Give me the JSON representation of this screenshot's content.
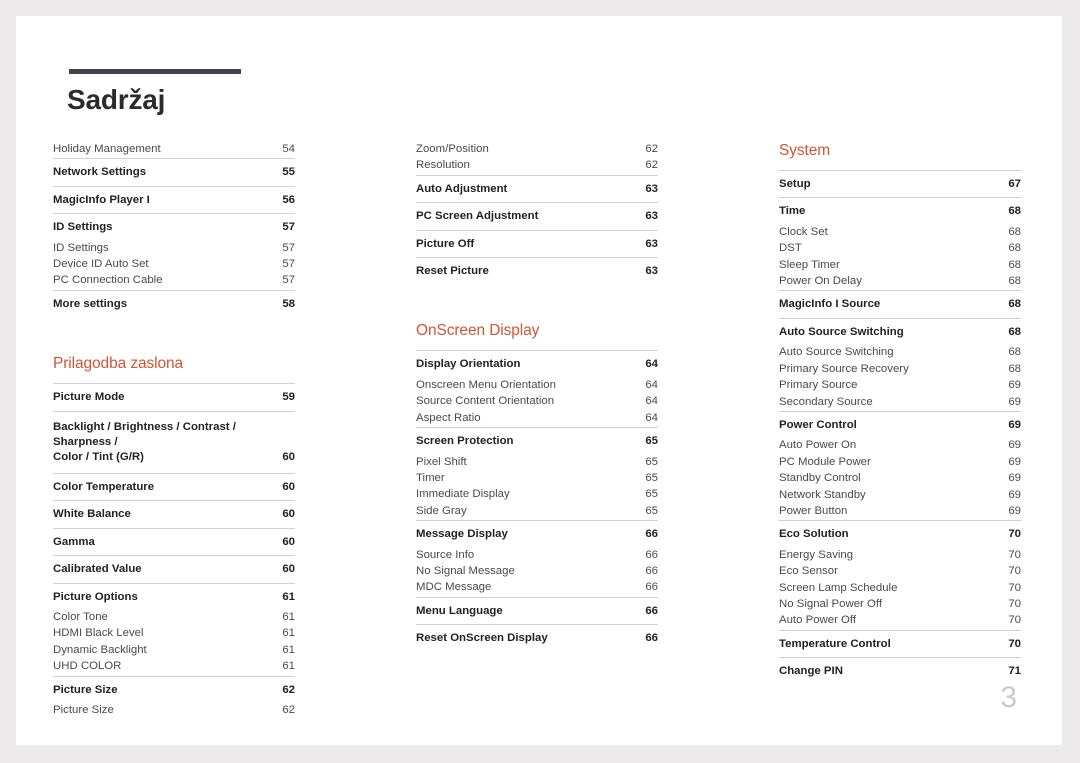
{
  "document": {
    "title": "Sadržaj",
    "folio": "3",
    "accent_color": "#cf5537",
    "rule_color": "#454250"
  },
  "columns": [
    {
      "name": "column-1",
      "groups": [
        {
          "rule": false,
          "entries": [
            {
              "label": "Holiday Management",
              "page": "54",
              "style": "sub"
            }
          ]
        },
        {
          "rule": true,
          "entries": [
            {
              "label": "Network Settings",
              "page": "55",
              "style": "head"
            }
          ]
        },
        {
          "rule": true,
          "entries": [
            {
              "label": "MagicInfo Player I",
              "page": "56",
              "style": "head"
            }
          ]
        },
        {
          "rule": true,
          "entries": [
            {
              "label": "ID Settings",
              "page": "57",
              "style": "head"
            },
            {
              "label": "ID Settings",
              "page": "57",
              "style": "sub"
            },
            {
              "label": "Device ID Auto Set",
              "page": "57",
              "style": "sub"
            },
            {
              "label": "PC Connection Cable",
              "page": "57",
              "style": "sub"
            }
          ]
        },
        {
          "rule": true,
          "entries": [
            {
              "label": "More settings",
              "page": "58",
              "style": "head"
            }
          ]
        }
      ],
      "section": {
        "heading": "Prilagodba zaslona",
        "groups": [
          {
            "rule": true,
            "entries": [
              {
                "label": "Picture Mode",
                "page": "59",
                "style": "head"
              }
            ]
          },
          {
            "rule": true,
            "entries": [
              {
                "label": "Backlight / Brightness / Contrast / Sharpness /",
                "label2": "Color / Tint (G/R)",
                "page": "60",
                "style": "wrap"
              }
            ]
          },
          {
            "rule": true,
            "entries": [
              {
                "label": "Color Temperature",
                "page": "60",
                "style": "head"
              }
            ]
          },
          {
            "rule": true,
            "entries": [
              {
                "label": "White Balance",
                "page": "60",
                "style": "head"
              }
            ]
          },
          {
            "rule": true,
            "entries": [
              {
                "label": "Gamma",
                "page": "60",
                "style": "head"
              }
            ]
          },
          {
            "rule": true,
            "entries": [
              {
                "label": "Calibrated Value",
                "page": "60",
                "style": "head"
              }
            ]
          },
          {
            "rule": true,
            "entries": [
              {
                "label": "Picture Options",
                "page": "61",
                "style": "head"
              },
              {
                "label": "Color Tone",
                "page": "61",
                "style": "sub"
              },
              {
                "label": "HDMI Black Level",
                "page": "61",
                "style": "sub"
              },
              {
                "label": "Dynamic Backlight",
                "page": "61",
                "style": "sub"
              },
              {
                "label": "UHD COLOR",
                "page": "61",
                "style": "sub"
              }
            ]
          },
          {
            "rule": true,
            "entries": [
              {
                "label": "Picture Size",
                "page": "62",
                "style": "head"
              },
              {
                "label": "Picture Size",
                "page": "62",
                "style": "sub"
              }
            ]
          }
        ]
      }
    },
    {
      "name": "column-2",
      "groups": [
        {
          "rule": false,
          "entries": [
            {
              "label": "Zoom/Position",
              "page": "62",
              "style": "sub"
            },
            {
              "label": "Resolution",
              "page": "62",
              "style": "sub"
            }
          ]
        },
        {
          "rule": true,
          "entries": [
            {
              "label": "Auto Adjustment",
              "page": "63",
              "style": "head"
            }
          ]
        },
        {
          "rule": true,
          "entries": [
            {
              "label": "PC Screen Adjustment",
              "page": "63",
              "style": "head"
            }
          ]
        },
        {
          "rule": true,
          "entries": [
            {
              "label": "Picture Off",
              "page": "63",
              "style": "head"
            }
          ]
        },
        {
          "rule": true,
          "entries": [
            {
              "label": "Reset Picture",
              "page": "63",
              "style": "head"
            }
          ]
        }
      ],
      "section": {
        "heading": "OnScreen Display",
        "groups": [
          {
            "rule": true,
            "entries": [
              {
                "label": "Display Orientation",
                "page": "64",
                "style": "head"
              },
              {
                "label": "Onscreen Menu Orientation",
                "page": "64",
                "style": "sub"
              },
              {
                "label": "Source Content Orientation",
                "page": "64",
                "style": "sub"
              },
              {
                "label": "Aspect Ratio",
                "page": "64",
                "style": "sub"
              }
            ]
          },
          {
            "rule": true,
            "entries": [
              {
                "label": "Screen Protection",
                "page": "65",
                "style": "head"
              },
              {
                "label": "Pixel Shift",
                "page": "65",
                "style": "sub"
              },
              {
                "label": "Timer",
                "page": "65",
                "style": "sub"
              },
              {
                "label": "Immediate Display",
                "page": "65",
                "style": "sub"
              },
              {
                "label": "Side Gray",
                "page": "65",
                "style": "sub"
              }
            ]
          },
          {
            "rule": true,
            "entries": [
              {
                "label": "Message Display",
                "page": "66",
                "style": "head"
              },
              {
                "label": "Source Info",
                "page": "66",
                "style": "sub"
              },
              {
                "label": "No Signal Message",
                "page": "66",
                "style": "sub"
              },
              {
                "label": "MDC Message",
                "page": "66",
                "style": "sub"
              }
            ]
          },
          {
            "rule": true,
            "entries": [
              {
                "label": "Menu Language",
                "page": "66",
                "style": "head"
              }
            ]
          },
          {
            "rule": true,
            "entries": [
              {
                "label": "Reset OnScreen Display",
                "page": "66",
                "style": "head"
              }
            ]
          }
        ]
      }
    },
    {
      "name": "column-3",
      "groups": [],
      "section": {
        "heading": "System",
        "groups": [
          {
            "rule": true,
            "entries": [
              {
                "label": "Setup",
                "page": "67",
                "style": "head"
              }
            ]
          },
          {
            "rule": true,
            "entries": [
              {
                "label": "Time",
                "page": "68",
                "style": "head"
              },
              {
                "label": "Clock Set",
                "page": "68",
                "style": "sub"
              },
              {
                "label": "DST",
                "page": "68",
                "style": "sub"
              },
              {
                "label": "Sleep Timer",
                "page": "68",
                "style": "sub"
              },
              {
                "label": "Power On Delay",
                "page": "68",
                "style": "sub"
              }
            ]
          },
          {
            "rule": true,
            "entries": [
              {
                "label": "MagicInfo I Source",
                "page": "68",
                "style": "head"
              }
            ]
          },
          {
            "rule": true,
            "entries": [
              {
                "label": "Auto Source Switching",
                "page": "68",
                "style": "head"
              },
              {
                "label": "Auto Source Switching",
                "page": "68",
                "style": "sub"
              },
              {
                "label": "Primary Source Recovery",
                "page": "68",
                "style": "sub"
              },
              {
                "label": "Primary Source",
                "page": "69",
                "style": "sub"
              },
              {
                "label": "Secondary Source",
                "page": "69",
                "style": "sub"
              }
            ]
          },
          {
            "rule": true,
            "entries": [
              {
                "label": "Power Control",
                "page": "69",
                "style": "head"
              },
              {
                "label": "Auto Power On",
                "page": "69",
                "style": "sub"
              },
              {
                "label": "PC Module Power",
                "page": "69",
                "style": "sub"
              },
              {
                "label": "Standby Control",
                "page": "69",
                "style": "sub"
              },
              {
                "label": "Network Standby",
                "page": "69",
                "style": "sub"
              },
              {
                "label": "Power Button",
                "page": "69",
                "style": "sub"
              }
            ]
          },
          {
            "rule": true,
            "entries": [
              {
                "label": "Eco Solution",
                "page": "70",
                "style": "head"
              },
              {
                "label": "Energy Saving",
                "page": "70",
                "style": "sub"
              },
              {
                "label": "Eco Sensor",
                "page": "70",
                "style": "sub"
              },
              {
                "label": "Screen Lamp Schedule",
                "page": "70",
                "style": "sub"
              },
              {
                "label": "No Signal Power Off",
                "page": "70",
                "style": "sub"
              },
              {
                "label": "Auto Power Off",
                "page": "70",
                "style": "sub"
              }
            ]
          },
          {
            "rule": true,
            "entries": [
              {
                "label": "Temperature Control",
                "page": "70",
                "style": "head"
              }
            ]
          },
          {
            "rule": true,
            "entries": [
              {
                "label": "Change PIN",
                "page": "71",
                "style": "head"
              }
            ]
          }
        ]
      }
    }
  ]
}
